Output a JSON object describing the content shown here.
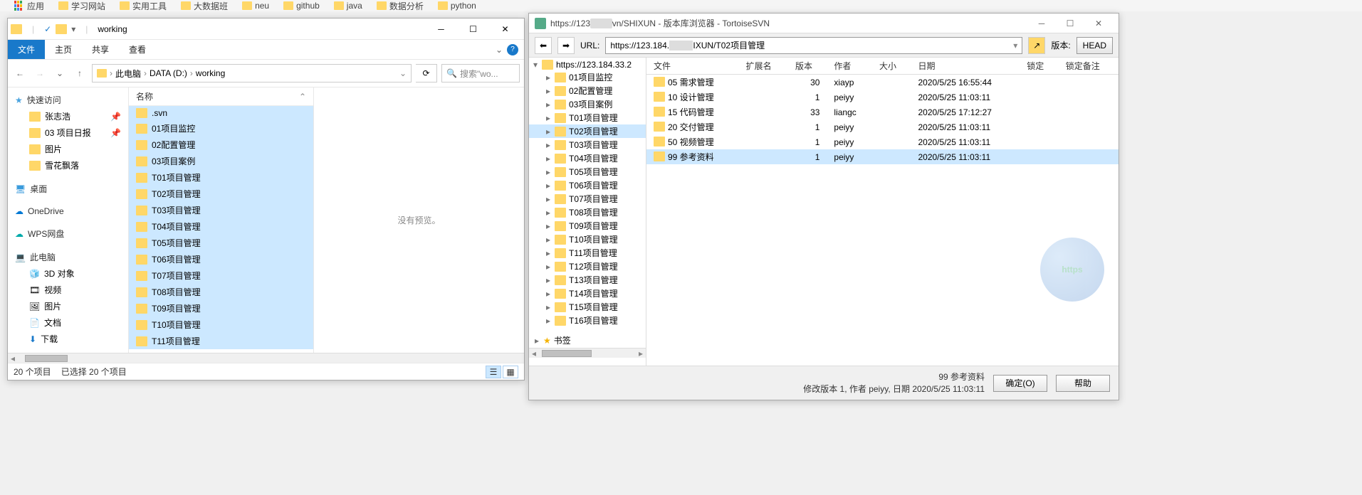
{
  "bookmarks": [
    "应用",
    "学习网站",
    "实用工具",
    "大数据班",
    "neu",
    "github",
    "java",
    "数据分析",
    "python"
  ],
  "explorer": {
    "title": "working",
    "tabs": {
      "file": "文件",
      "home": "主页",
      "share": "共享",
      "view": "查看"
    },
    "breadcrumb": [
      "此电脑",
      "DATA (D:)",
      "working"
    ],
    "search_placeholder": "搜索\"wo...",
    "nav": {
      "quick_access": "快速访问",
      "quick_items": [
        "张志浩",
        "03 项目日报",
        "图片",
        "雪花飘落"
      ],
      "desktop": "桌面",
      "onedrive": "OneDrive",
      "wps": "WPS网盘",
      "this_pc": "此电脑",
      "pc_items": [
        "3D 对象",
        "视频",
        "图片",
        "文档",
        "下载"
      ]
    },
    "list_header": "名称",
    "files": [
      ".svn",
      "01项目监控",
      "02配置管理",
      "03项目案例",
      "T01项目管理",
      "T02项目管理",
      "T03项目管理",
      "T04项目管理",
      "T05项目管理",
      "T06项目管理",
      "T07项目管理",
      "T08项目管理",
      "T09项目管理",
      "T10项目管理",
      "T11项目管理"
    ],
    "preview_text": "没有预览。",
    "status": {
      "items": "20 个项目",
      "selected": "已选择 20 个项目"
    }
  },
  "svn": {
    "title_prefix": "https://123",
    "title_redacted": "........",
    "title_suffix": "vn/SHIXUN - 版本库浏览器 - TortoiseSVN",
    "url_label": "URL:",
    "url_prefix": "https://123.184.",
    "url_redacted": "..........",
    "url_suffix": "IXUN/T02项目管理",
    "rev_label": "版本:",
    "rev_button": "HEAD",
    "tree_root": "https://123.184.33.2",
    "tree": [
      "01项目监控",
      "02配置管理",
      "03项目案例",
      "T01项目管理",
      "T02项目管理",
      "T03项目管理",
      "T04项目管理",
      "T05项目管理",
      "T06项目管理",
      "T07项目管理",
      "T08项目管理",
      "T09项目管理",
      "T10项目管理",
      "T11项目管理",
      "T12项目管理",
      "T13项目管理",
      "T14项目管理",
      "T15项目管理",
      "T16项目管理"
    ],
    "tree_selected_index": 4,
    "bookmarks_label": "书签",
    "columns": [
      "文件",
      "扩展名",
      "版本",
      "作者",
      "大小",
      "日期",
      "锁定",
      "锁定备注"
    ],
    "rows": [
      {
        "file": "05 需求管理",
        "ext": "",
        "rev": "30",
        "author": "xiayp",
        "size": "",
        "date": "2020/5/25 16:55:44"
      },
      {
        "file": "10 设计管理",
        "ext": "",
        "rev": "1",
        "author": "peiyy",
        "size": "",
        "date": "2020/5/25 11:03:11"
      },
      {
        "file": "15 代码管理",
        "ext": "",
        "rev": "33",
        "author": "liangc",
        "size": "",
        "date": "2020/5/25 17:12:27"
      },
      {
        "file": "20 交付管理",
        "ext": "",
        "rev": "1",
        "author": "peiyy",
        "size": "",
        "date": "2020/5/25 11:03:11"
      },
      {
        "file": "50 视频管理",
        "ext": "",
        "rev": "1",
        "author": "peiyy",
        "size": "",
        "date": "2020/5/25 11:03:11"
      },
      {
        "file": "99 参考资料",
        "ext": "",
        "rev": "1",
        "author": "peiyy",
        "size": "",
        "date": "2020/5/25 11:03:11"
      }
    ],
    "selected_row_index": 5,
    "status_line1": "99 参考资料",
    "status_line2": "修改版本 1, 作者 peiyy, 日期 2020/5/25 11:03:11",
    "ok": "确定(O)",
    "help": "帮助",
    "globe_text": "https"
  }
}
